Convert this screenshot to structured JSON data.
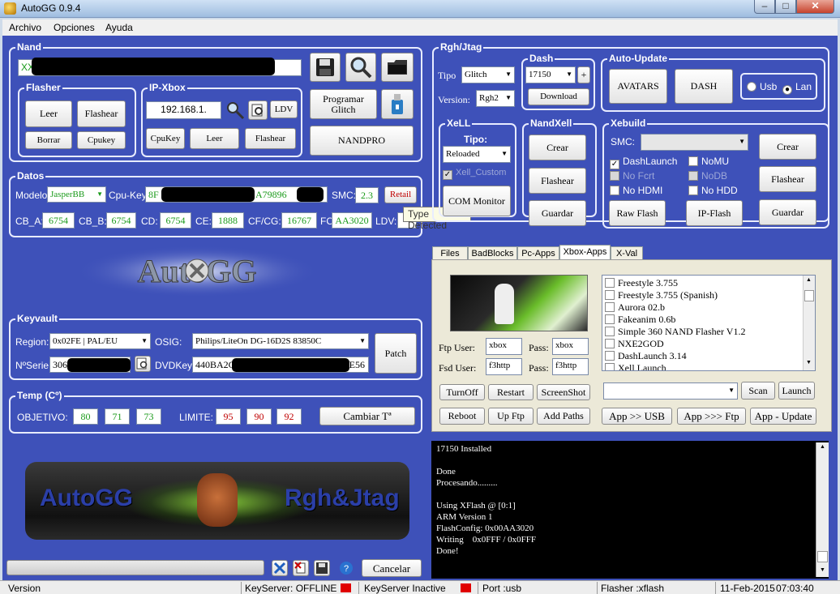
{
  "window": {
    "title": "AutoGG 0.9.4"
  },
  "menu": [
    "Archivo",
    "Opciones",
    "Ayuda"
  ],
  "nand": {
    "title": "Nand",
    "path_prefix": "XX",
    "flasher": {
      "title": "Flasher",
      "read": "Leer",
      "flash": "Flashear",
      "erase": "Borrar",
      "cpukey": "Cpukey"
    },
    "ipxbox": {
      "title": "IP-Xbox",
      "ip": "192.168.1.",
      "ldv": "LDV",
      "cpukey": "CpuKey",
      "read": "Leer",
      "flash": "Flashear"
    },
    "program_glitch": "Programar Glitch",
    "nandpro": "NANDPRO"
  },
  "datos": {
    "title": "Datos",
    "model_label": "Modelo:",
    "model": "JasperBB",
    "cpukey_label": "Cpu-Key",
    "cpukey_prefix": "8F",
    "cpukey_suffix": "A79896",
    "smc_label": "SMC:",
    "smc": "2.3",
    "retail": "Retail",
    "tooltip": "Type Detected",
    "cb_a_label": "CB_A:",
    "cb_a": "6754",
    "cb_b_label": "CB_B:",
    "cb_b": "6754",
    "cd_label": "CD:",
    "cd": "6754",
    "ce_label": "CE:",
    "ce": "1888",
    "cfcg_label": "CF/CG:",
    "cfcg": "16767",
    "fc_label": "FC:",
    "fc": "AA3020",
    "ldv_label": "LDV:"
  },
  "keyvault": {
    "title": "Keyvault",
    "region_label": "Region:",
    "region": "0x02FE  |  PAL/EU",
    "osig_label": "OSIG:",
    "osig": "Philips/LiteOn DG-16D2S 83850C",
    "serial_label": "NºSerie:",
    "serial_prefix": "3061",
    "dvdkey_label": "DVDKey:",
    "dvdkey_prefix": "440BA2C",
    "dvdkey_suffix": "E56",
    "patch": "Patch"
  },
  "temp": {
    "title": "Temp (Cº)",
    "target_label": "OBJETIVO:",
    "target": [
      "80",
      "71",
      "73"
    ],
    "limit_label": "LIMITE:",
    "limit": [
      "95",
      "90",
      "92"
    ],
    "change": "Cambiar Tª"
  },
  "banner": {
    "left": "AutoGG",
    "right": "Rgh&Jtag"
  },
  "bottom": {
    "cancel": "Cancelar"
  },
  "rgh": {
    "title": "Rgh/Jtag",
    "tipo_label": "Tipo",
    "tipo": "Glitch",
    "version_label": "Version:",
    "version": "Rgh2",
    "dash": {
      "title": "Dash",
      "value": "17150",
      "plus": "+",
      "download": "Download"
    },
    "autoupdate": {
      "title": "Auto-Update",
      "avatars": "AVATARS",
      "dash": "DASH",
      "usb": "Usb",
      "lan": "Lan"
    },
    "xell": {
      "title": "XeLL",
      "tipo_label": "Tipo:",
      "tipo": "Reloaded",
      "check": "Xell_Custom",
      "com": "COM Monitor"
    },
    "nandxell": {
      "title": "NandXell",
      "create": "Crear",
      "flash": "Flashear",
      "save": "Guardar"
    },
    "xebuild": {
      "title": "Xebuild",
      "smc_label": "SMC:",
      "checks": [
        "DashLaunch",
        "NoMU",
        "No Fcrt",
        "NoDB",
        "No HDMI",
        "No HDD"
      ],
      "raw_flash": "Raw Flash",
      "ip_flash": "IP-Flash",
      "create": "Crear",
      "flash": "Flashear",
      "save": "Guardar"
    }
  },
  "tabs": [
    "Files",
    "BadBlocks",
    "Pc-Apps",
    "Xbox-Apps",
    "X-Val"
  ],
  "xbox_apps": {
    "ftp_user_label": "Ftp User:",
    "ftp_user": "xbox",
    "ftp_pass_label": "Pass:",
    "ftp_pass": "xbox",
    "fsd_user_label": "Fsd User:",
    "fsd_user": "f3http",
    "fsd_pass_label": "Pass:",
    "fsd_pass": "f3http",
    "apps": [
      "Freestyle 3.755",
      "Freestyle 3.755 (Spanish)",
      "Aurora 02.b",
      "Fakeanim 0.6b",
      "Simple 360 NAND Flasher V1.2",
      "NXE2GOD",
      "DashLaunch 3.14",
      "Xell Launch"
    ],
    "turnoff": "TurnOff",
    "restart": "Restart",
    "screenshot": "ScreenShot",
    "reboot": "Reboot",
    "upftp": "Up Ftp",
    "addpaths": "Add Paths",
    "scan": "Scan",
    "launch": "Launch",
    "app_usb": "App >> USB",
    "app_ftp": "App >>> Ftp",
    "app_update": "App - Update"
  },
  "console": [
    "17150 Installed",
    "",
    "Done",
    "Procesando.........",
    "",
    "Using XFlash @ [0:1]",
    "ARM Version 1",
    "FlashConfig: 0x00AA3020",
    "Writing    0x0FFF / 0x0FFF",
    "Done!"
  ],
  "status": {
    "version": "Version",
    "keyserver": "KeyServer: OFFLINE",
    "keyserver_state": "KeyServer Inactive",
    "port": "Port :usb",
    "flasher": "Flasher :xflash",
    "date": "11-Feb-2015",
    "time": "07:03:40"
  }
}
